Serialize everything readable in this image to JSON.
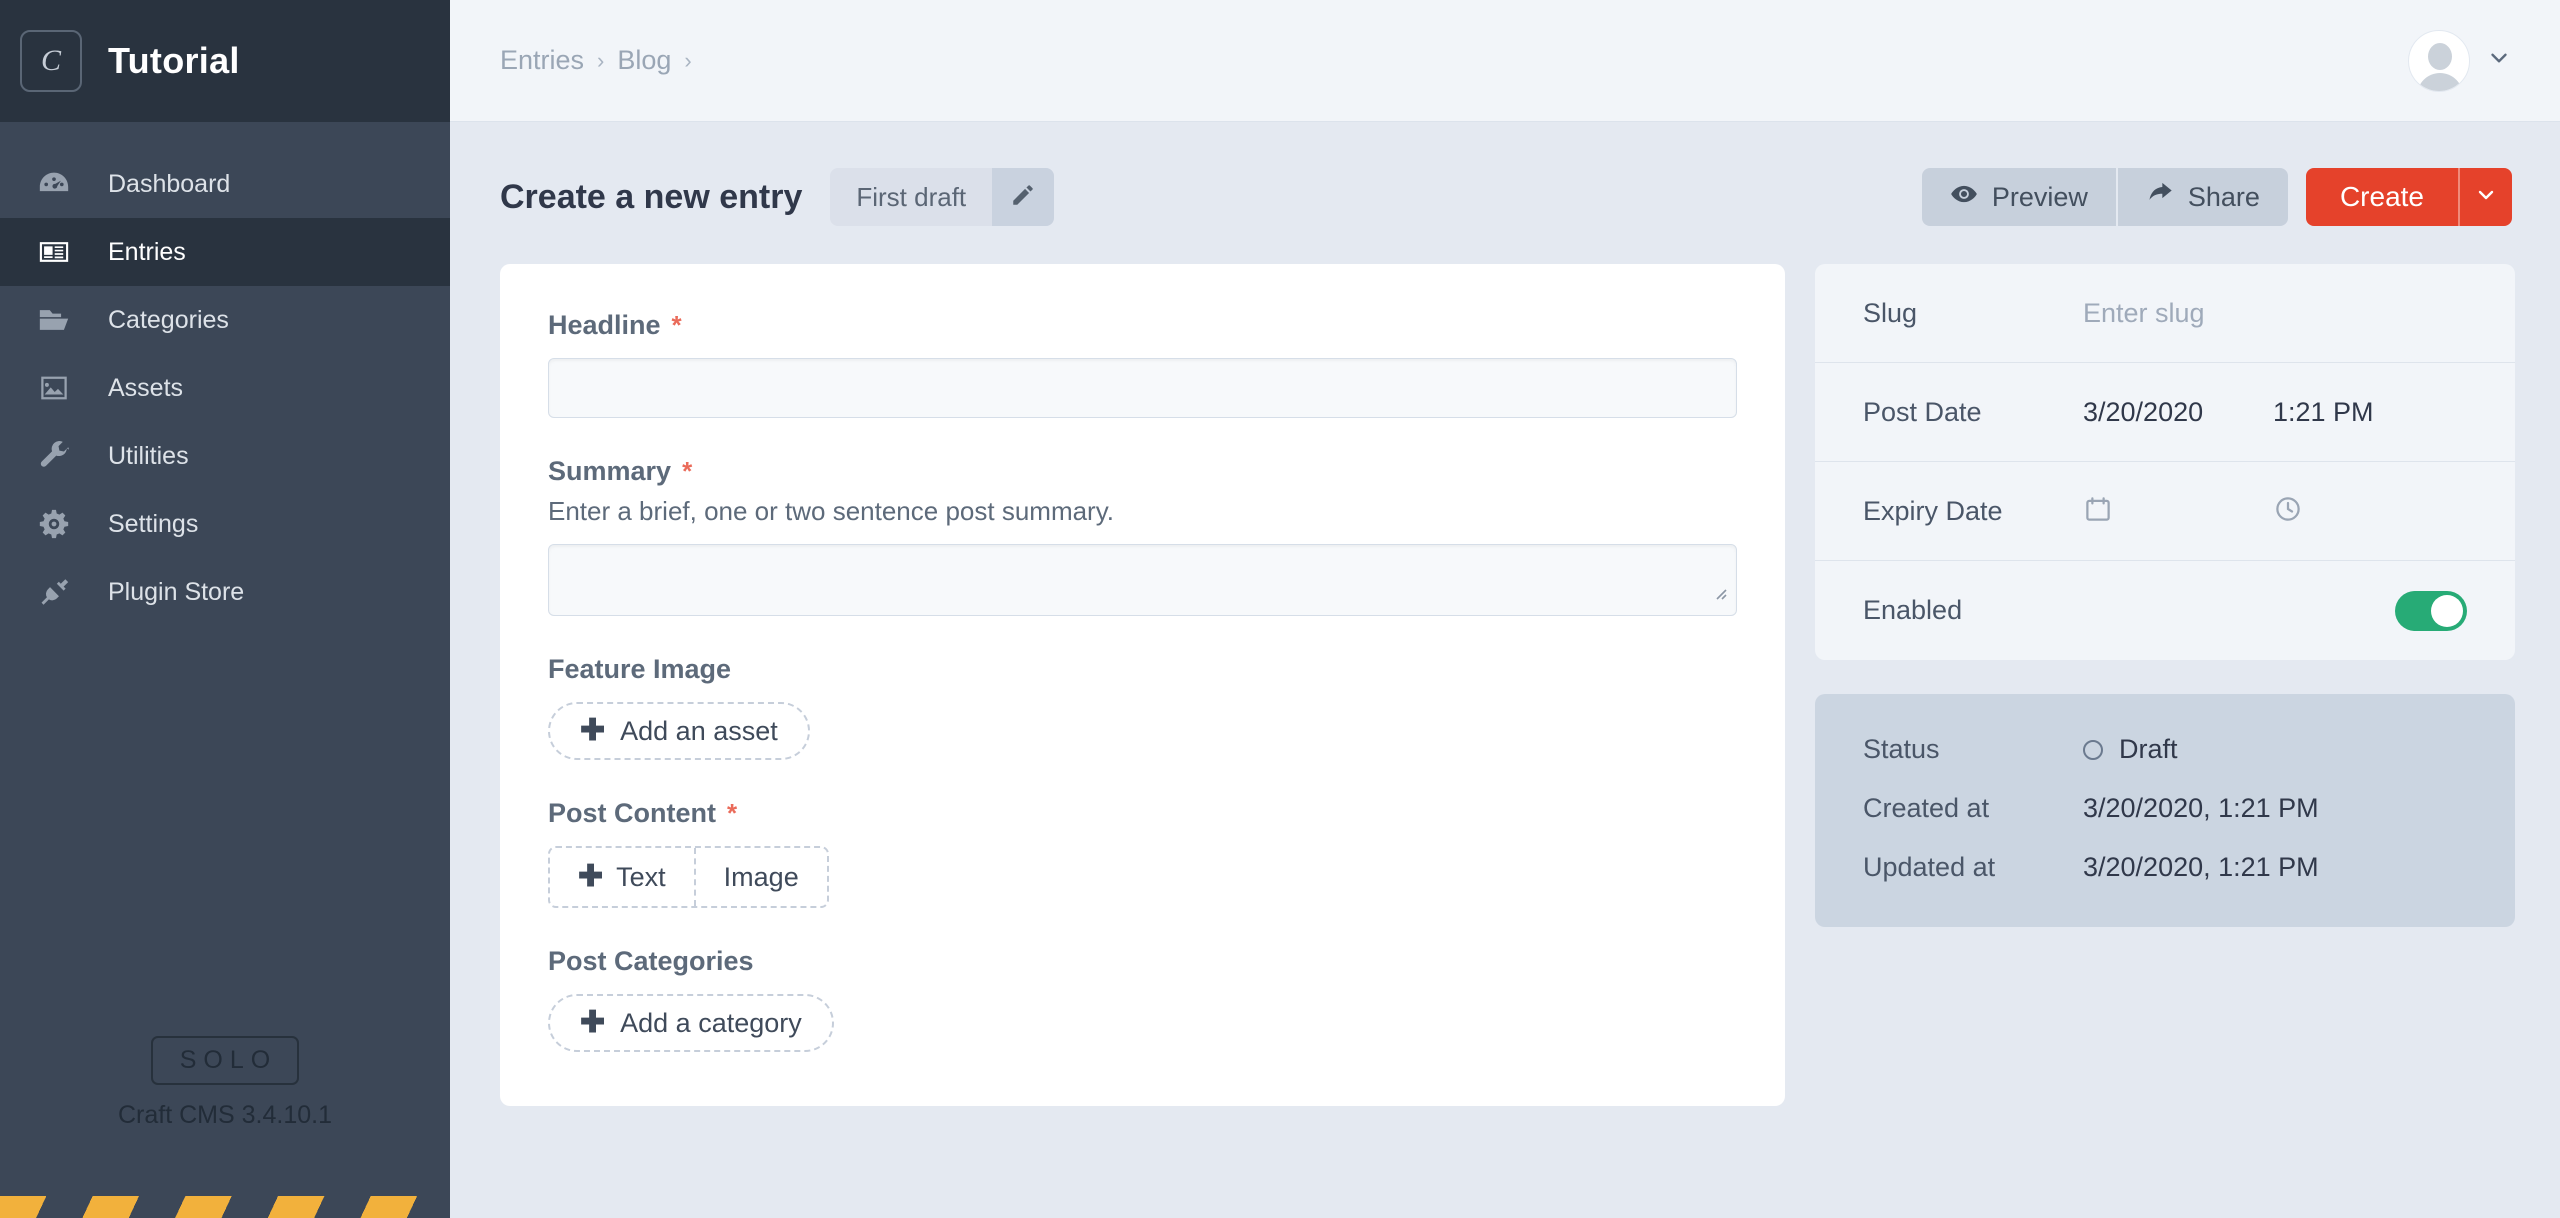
{
  "sidebar": {
    "logo_letter": "C",
    "site_title": "Tutorial",
    "items": [
      {
        "label": "Dashboard",
        "icon": "gauge-icon",
        "active": false
      },
      {
        "label": "Entries",
        "icon": "newspaper-icon",
        "active": true
      },
      {
        "label": "Categories",
        "icon": "folder-icon",
        "active": false
      },
      {
        "label": "Assets",
        "icon": "image-icon",
        "active": false
      },
      {
        "label": "Utilities",
        "icon": "wrench-icon",
        "active": false
      },
      {
        "label": "Settings",
        "icon": "gear-icon",
        "active": false
      },
      {
        "label": "Plugin Store",
        "icon": "plug-icon",
        "active": false
      }
    ],
    "edition_badge": "SOLO",
    "version": "Craft CMS 3.4.10.1"
  },
  "topbar": {
    "breadcrumbs": [
      "Entries",
      "Blog"
    ],
    "separator": "›"
  },
  "page": {
    "title": "Create a new entry",
    "draft_label": "First draft",
    "preview_label": "Preview",
    "share_label": "Share",
    "create_label": "Create"
  },
  "form": {
    "headline": {
      "label": "Headline",
      "required": "*",
      "value": "",
      "placeholder": ""
    },
    "summary": {
      "label": "Summary",
      "required": "*",
      "hint": "Enter a brief, one or two sentence post summary.",
      "value": "",
      "placeholder": ""
    },
    "feature_image": {
      "label": "Feature Image",
      "add_label": "Add an asset"
    },
    "post_content": {
      "label": "Post Content",
      "required": "*",
      "text_label": "Text",
      "image_label": "Image"
    },
    "post_categories": {
      "label": "Post Categories",
      "add_label": "Add a category"
    }
  },
  "meta": {
    "slug": {
      "key": "Slug",
      "placeholder": "Enter slug",
      "value": ""
    },
    "post_date": {
      "key": "Post Date",
      "date": "3/20/2020",
      "time": "1:21 PM"
    },
    "expiry_date": {
      "key": "Expiry Date",
      "date": "",
      "time": ""
    },
    "enabled": {
      "key": "Enabled",
      "value": "on"
    }
  },
  "status": {
    "status_key": "Status",
    "status_value": "Draft",
    "created_key": "Created at",
    "created_value": "3/20/2020, 1:21 PM",
    "updated_key": "Updated at",
    "updated_value": "3/20/2020, 1:21 PM"
  },
  "colors": {
    "accent_red": "#E5422B",
    "toggle_green": "#27AB76",
    "sidebar": "#3C4757",
    "sidebar_dark": "#29333F",
    "required_red": "#EA6B5A",
    "hazard_yellow": "#F2B13C"
  }
}
